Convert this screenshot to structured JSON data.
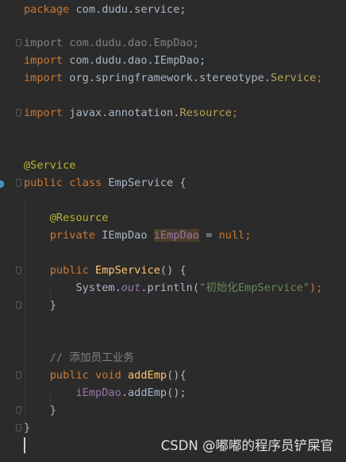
{
  "code": {
    "l1_kw": "package",
    "l1_rest": " com.dudu.service;",
    "l3_kw": "import",
    "l3_rest": " com.dudu.dao.EmpDao;",
    "l4_kw": "import",
    "l4_rest": " com.dudu.dao.IEmpDao;",
    "l5_kw": "import",
    "l5_pkg": " org.springframework.stereotype.",
    "l5_cls": "Service",
    "l5_semi": ";",
    "l7_kw": "import",
    "l7_pkg": " javax.annotation.",
    "l7_cls": "Resource",
    "l7_semi": ";",
    "l10_annot": "@Service",
    "l11_kw": "public class",
    "l11_rest": " EmpService {",
    "l13_annot": "@Resource",
    "l14_kw": "private",
    "l14_type": " IEmpDao ",
    "l14_field": "iEmpDao",
    "l14_eq": " = ",
    "l14_null": "null",
    "l14_semi": ";",
    "l16_kw": "public",
    "l16_fn": "EmpService",
    "l16_rest": "() {",
    "l17_sys": "System.",
    "l17_out": "out",
    "l17_call": ".println(",
    "l17_str": "\"初始化EmpService\"",
    "l17_end": ");",
    "l18_brace": "}",
    "l21_comment": "// 添加员工业务",
    "l22_kw": "public void",
    "l22_fn": "addEmp",
    "l22_rest": "(){",
    "l23_field": "iEmpDao",
    "l23_rest": ".addEmp();",
    "l24_brace": "}",
    "l25_brace": "}"
  },
  "watermark": "CSDN @嘟嘟的程序员铲屎官"
}
